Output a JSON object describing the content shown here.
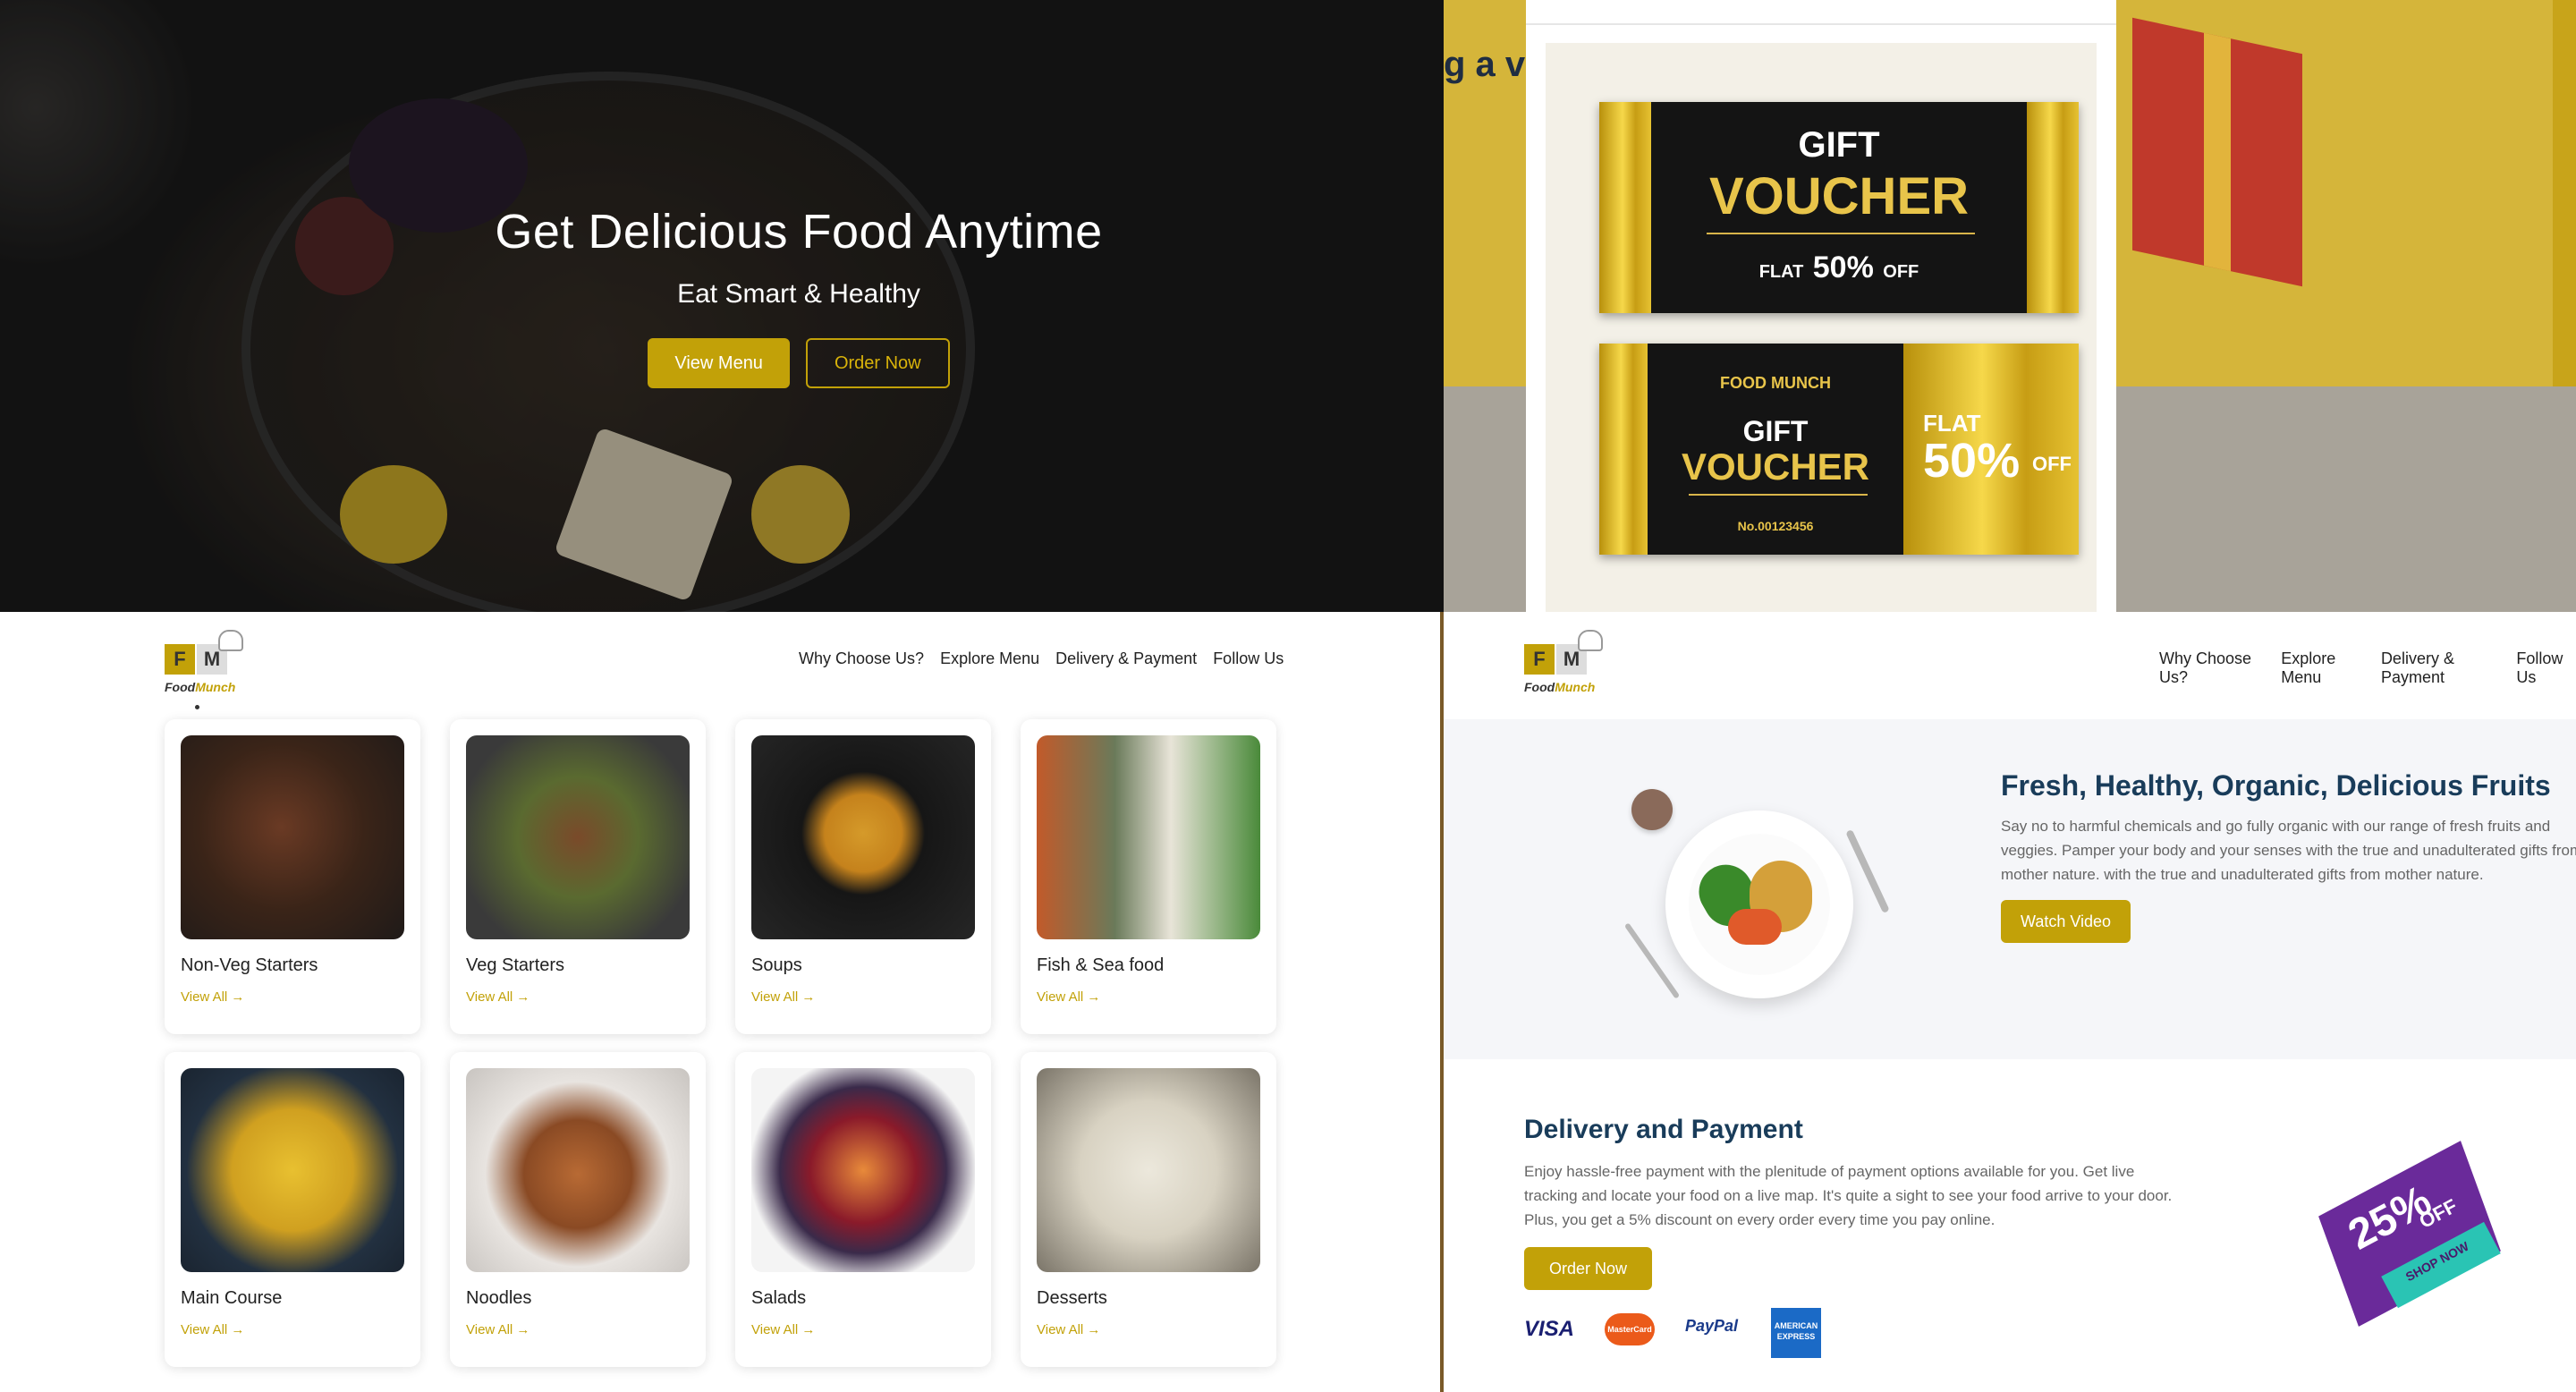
{
  "hero": {
    "title": "Get Delicious Food Anytime",
    "subtitle": "Eat Smart & Healthy",
    "view_menu": "View Menu",
    "order_now": "Order Now"
  },
  "voucher_modal": {
    "background_peek_text": "g a va",
    "voucher1": {
      "line1": "GIFT",
      "line2": "VOUCHER",
      "flat": "FLAT",
      "percent": "50%",
      "off": "OFF"
    },
    "voucher2": {
      "brand": "FOOD MUNCH",
      "line1": "GIFT",
      "line2": "VOUCHER",
      "number": "No.00123456",
      "flat": "FLAT",
      "percent": "50%",
      "off": "OFF"
    }
  },
  "nav": {
    "logo_f": "F",
    "logo_m": "M",
    "logo_food": "Food",
    "logo_munch": "Munch",
    "links": [
      "Why Choose Us?",
      "Explore Menu",
      "Delivery & Payment",
      "Follow Us"
    ]
  },
  "menu": {
    "view_all": "View All →",
    "items": [
      {
        "title": "Non-Veg Starters",
        "icon": "grilled-meat-image"
      },
      {
        "title": "Veg Starters",
        "icon": "tofu-bowl-image"
      },
      {
        "title": "Soups",
        "icon": "soup-bowl-image"
      },
      {
        "title": "Fish & Sea food",
        "icon": "grilled-fish-image"
      },
      {
        "title": "Main Course",
        "icon": "biryani-image"
      },
      {
        "title": "Noodles",
        "icon": "noodles-image"
      },
      {
        "title": "Salads",
        "icon": "fruit-salad-image"
      },
      {
        "title": "Desserts",
        "icon": "ice-cream-image"
      }
    ]
  },
  "info": {
    "fresh_title": "Fresh, Healthy, Organic, Delicious Fruits",
    "fresh_text": "Say no to harmful chemicals and go fully organic with our range of fresh fruits and veggies. Pamper your body and your senses with the true and unadulterated gifts from mother nature. with the true and unadulterated gifts from mother nature.",
    "watch_video": "Watch Video",
    "dp_title": "Delivery and Payment",
    "dp_text": "Enjoy hassle-free payment with the plenitude of payment options available for you. Get live tracking and locate your food on a live map. It's quite a sight to see your food arrive to your door. Plus, you get a 5% discount on every order every time you pay online.",
    "order_now": "Order Now",
    "payments": [
      "VISA",
      "MasterCard",
      "PayPal",
      "AMERICAN EXPRESS"
    ],
    "badge_percent": "25%",
    "badge_off": "OFF",
    "badge_shop": "SHOP NOW"
  },
  "colors": {
    "gold": "#c2a108",
    "navy": "#193c5a"
  }
}
